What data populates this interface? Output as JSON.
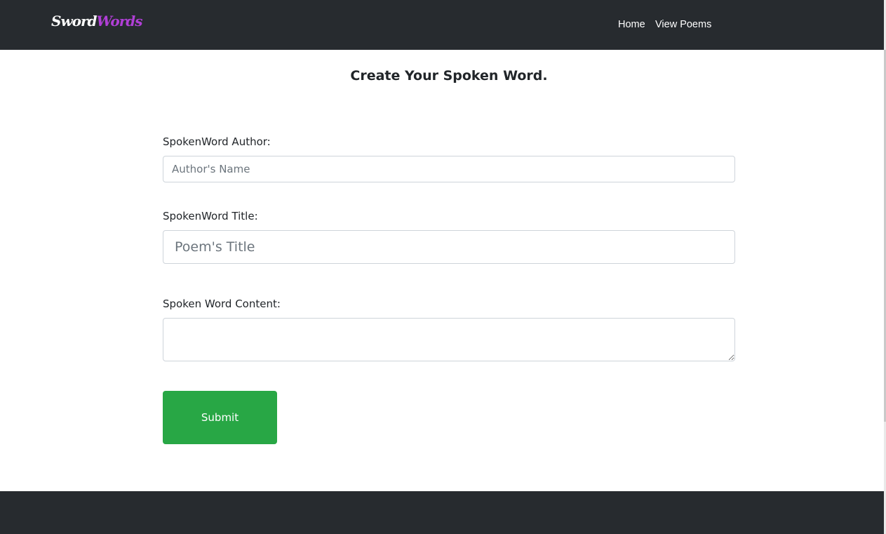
{
  "navbar": {
    "brand": {
      "part1": "Sword",
      "part2": "Words"
    },
    "links": [
      {
        "label": "Home"
      },
      {
        "label": "View Poems"
      }
    ]
  },
  "form": {
    "heading": "Create Your Spoken Word.",
    "author": {
      "label": "SpokenWord Author:",
      "placeholder": "Author's Name",
      "value": ""
    },
    "title": {
      "label": "SpokenWord Title:",
      "placeholder": "Poem's Title",
      "value": ""
    },
    "content": {
      "label": "Spoken Word Content:",
      "value": ""
    },
    "submit_label": "Submit"
  },
  "colors": {
    "navbar_bg": "#272b2f",
    "brand_accent": "#b03fd6",
    "submit_bg": "#28a745"
  }
}
